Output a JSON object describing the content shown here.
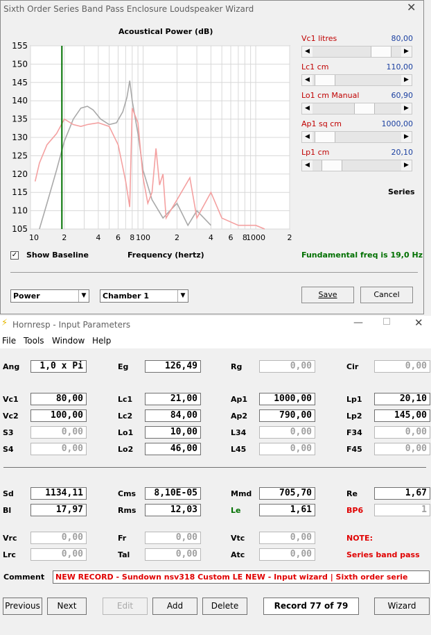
{
  "wizard": {
    "title": "Sixth Order Series Band Pass Enclosure Loudspeaker Wizard",
    "chart_title": "Acoustical Power (dB)",
    "x_axis_label": "Frequency (hertz)",
    "show_baseline_label": "Show Baseline",
    "fundamental_text": "Fundamental freq is 19,0 Hz",
    "series_label": "Series",
    "sliders": [
      {
        "label": "Vc1  litres",
        "value": "80,00",
        "position": 0.86
      },
      {
        "label": "Lc1  cm",
        "value": "110,00",
        "position": 0.03
      },
      {
        "label": "Lo1  cm  Manual",
        "value": "60,90",
        "position": 0.61
      },
      {
        "label": "Ap1  sq cm",
        "value": "1000,00",
        "position": 0.03
      },
      {
        "label": "Lp1  cm",
        "value": "20,10",
        "position": 0.13
      }
    ],
    "combo_power": "Power",
    "combo_chamber": "Chamber 1",
    "save_label": "Save",
    "cancel_label": "Cancel",
    "colors": {
      "baseline": "#a9a9a9",
      "current": "#f4a0a0",
      "marker": "#007000"
    }
  },
  "chart_data": {
    "type": "line",
    "title": "Acoustical Power (dB)",
    "xlabel": "Frequency (hertz)",
    "ylabel": "",
    "x_scale": "log",
    "xlim": [
      10,
      20000
    ],
    "ylim": [
      105,
      155
    ],
    "x_ticks": [
      "10",
      "2",
      "4",
      "6",
      "8",
      "100",
      "2",
      "4",
      "6",
      "8",
      "1000",
      "2"
    ],
    "y_ticks": [
      "155",
      "150",
      "145",
      "140",
      "135",
      "130",
      "125",
      "120",
      "115",
      "110",
      "105"
    ],
    "marker_x": 19,
    "series": [
      {
        "x": [
          12,
          14,
          17,
          20,
          24,
          28,
          32,
          36,
          42,
          50,
          58,
          66,
          72,
          76,
          80,
          90,
          100,
          120,
          150,
          200,
          250,
          300,
          400
        ],
        "values": [
          105,
          112,
          121,
          129,
          135,
          138,
          138.5,
          137.5,
          135,
          133.5,
          134,
          137,
          141,
          145.5,
          140,
          131,
          121,
          113,
          108,
          112,
          106,
          110,
          106
        ]
      },
      {
        "x": [
          11,
          12,
          14,
          17,
          20,
          24,
          28,
          32,
          40,
          50,
          60,
          70,
          76,
          80,
          90,
          100,
          110,
          120,
          130,
          140,
          150,
          160,
          200,
          260,
          300,
          400,
          500,
          700,
          1000,
          1200
        ],
        "values": [
          118,
          123,
          128,
          131,
          135,
          133.5,
          133,
          133.5,
          134,
          133,
          128,
          118,
          111,
          138,
          134,
          119,
          112,
          115,
          127,
          117,
          120,
          108,
          113,
          119,
          108,
          115,
          108,
          106,
          106,
          105
        ]
      }
    ]
  },
  "hornresp": {
    "title": "Hornresp - Input Parameters",
    "menu": [
      "File",
      "Tools",
      "Window",
      "Help"
    ],
    "rows": [
      [
        {
          "l": "Ang",
          "v": "1,0 x Pi"
        },
        {
          "l": "Eg",
          "v": "126,49"
        },
        {
          "l": "Rg",
          "v": "0,00"
        },
        {
          "l": "Cir",
          "v": "0,00"
        }
      ],
      [
        {
          "l": "Vc1",
          "v": "80,00"
        },
        {
          "l": "Lc1",
          "v": "21,00"
        },
        {
          "l": "Ap1",
          "v": "1000,00"
        },
        {
          "l": "Lp1",
          "v": "20,10"
        }
      ],
      [
        {
          "l": "Vc2",
          "v": "100,00"
        },
        {
          "l": "Lc2",
          "v": "84,00"
        },
        {
          "l": "Ap2",
          "v": "790,00"
        },
        {
          "l": "Lp2",
          "v": "145,00"
        }
      ],
      [
        {
          "l": "S3",
          "v": "0,00"
        },
        {
          "l": "Lo1",
          "v": "10,00"
        },
        {
          "l": "L34",
          "v": "0,00"
        },
        {
          "l": "F34",
          "v": "0,00"
        }
      ],
      [
        {
          "l": "S4",
          "v": "0,00"
        },
        {
          "l": "Lo2",
          "v": "46,00"
        },
        {
          "l": "L45",
          "v": "0,00"
        },
        {
          "l": "F45",
          "v": "0,00"
        }
      ],
      [
        {
          "l": "Sd",
          "v": "1134,11"
        },
        {
          "l": "Cms",
          "v": "8,10E-05"
        },
        {
          "l": "Mmd",
          "v": "705,70"
        },
        {
          "l": "Re",
          "v": "1,67"
        }
      ],
      [
        {
          "l": "Bl",
          "v": "17,97"
        },
        {
          "l": "Rms",
          "v": "12,03"
        },
        {
          "l": "Le",
          "v": "1,61"
        },
        {
          "l": "BP6",
          "v": "1"
        }
      ],
      [
        {
          "l": "Vrc",
          "v": "0,00"
        },
        {
          "l": "Fr",
          "v": "0,00"
        },
        {
          "l": "Vtc",
          "v": "0,00"
        },
        {
          "l": "NOTE:",
          "v": ""
        }
      ],
      [
        {
          "l": "Lrc",
          "v": "0,00"
        },
        {
          "l": "Tal",
          "v": "0,00"
        },
        {
          "l": "Atc",
          "v": "0,00"
        },
        {
          "l": "Series band pass",
          "v": ""
        }
      ]
    ],
    "comment_label": "Comment",
    "comment_value": "NEW RECORD - Sundown nsv318 Custom LE NEW - Input wizard | Sixth order serie",
    "buttons": {
      "previous": "Previous",
      "next": "Next",
      "edit": "Edit",
      "add": "Add",
      "delete": "Delete",
      "record": "Record 77 of 79",
      "wizard": "Wizard"
    }
  }
}
